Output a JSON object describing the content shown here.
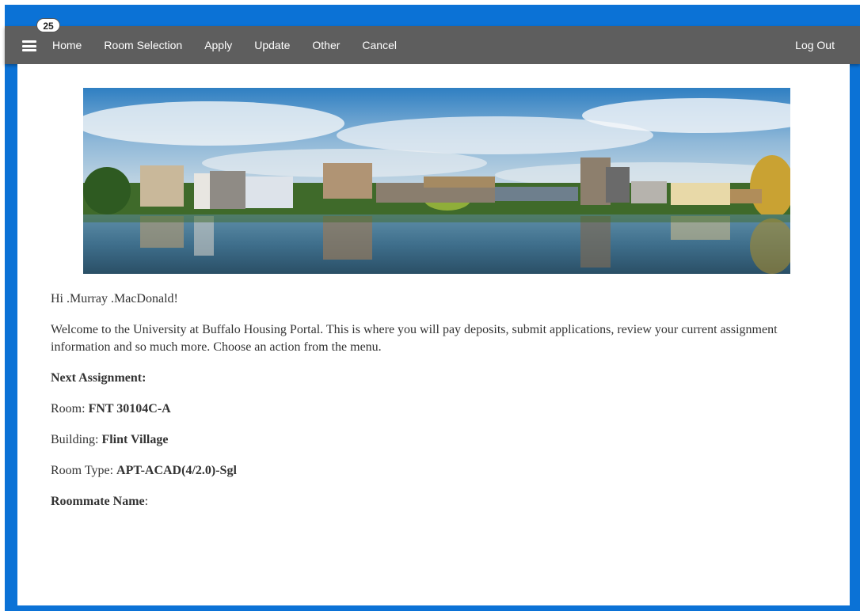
{
  "nav": {
    "badge": "25",
    "items": [
      "Home",
      "Room Selection",
      "Apply",
      "Update",
      "Other",
      "Cancel"
    ],
    "logout": "Log Out"
  },
  "greeting": "Hi .Murray .MacDonald!",
  "welcome": "Welcome to the University at Buffalo Housing Portal. This is where you will pay deposits, submit applications, review your current assignment information and so much more. Choose an action from the menu.",
  "assignment": {
    "heading": "Next Assignment:",
    "room_label": "Room: ",
    "room_value": "FNT 30104C-A",
    "building_label": "Building: ",
    "building_value": "Flint Village",
    "type_label": "Room Type: ",
    "type_value": "APT-ACAD(4/2.0)-Sgl",
    "roommate_label": "Roommate Name",
    "roommate_colon": ":"
  },
  "colors": {
    "frame": "#0b72d6",
    "navbar": "#5e5e5e",
    "text": "#333333"
  }
}
